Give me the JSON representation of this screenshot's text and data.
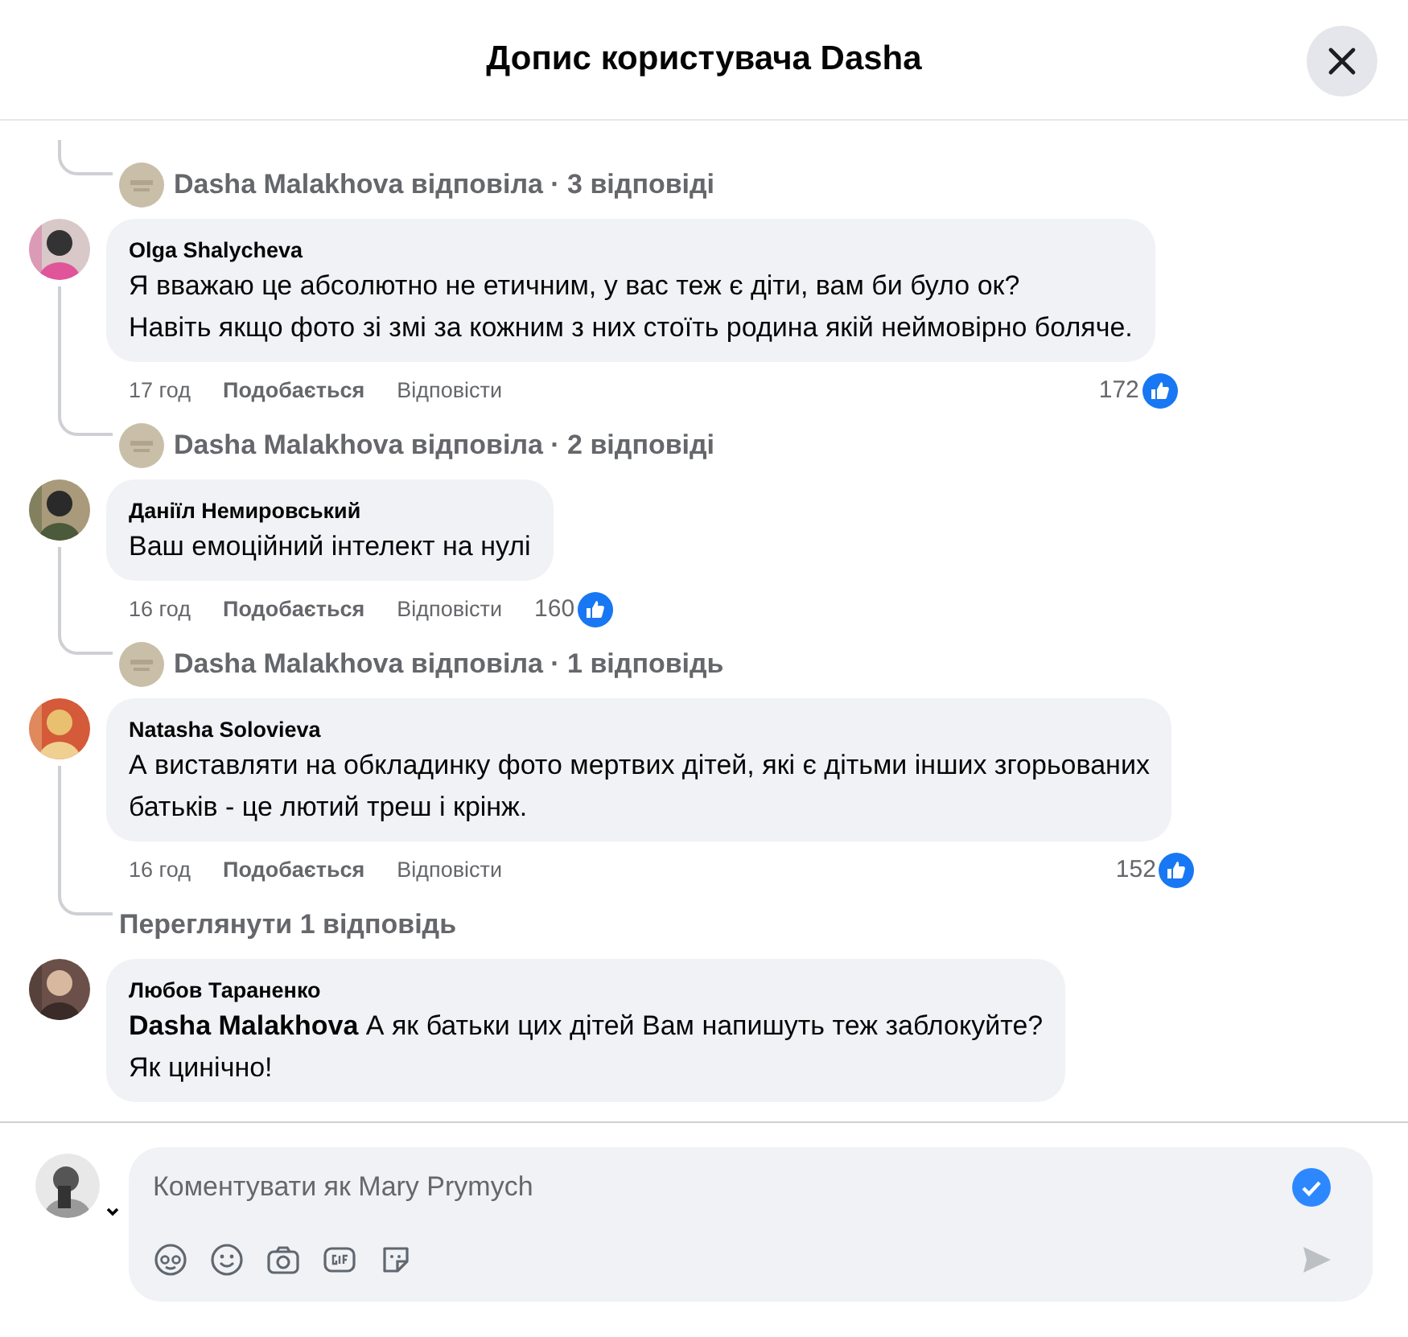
{
  "dialog": {
    "title": "Допис користувача Dasha"
  },
  "feed": [
    {
      "kind": "reply_summary",
      "text": "Dasha Malakhova відповіла · 3 відповіді"
    },
    {
      "kind": "comment",
      "author": "Olga Shalycheva",
      "lines": [
        "Я вважаю це абсолютно не етичним, у вас теж є діти, вам би було ок?",
        "Навіть якщо фото зі змі за кожним з них стоїть родина якій неймовірно боляче."
      ],
      "time": "17 год",
      "like": "Подобається",
      "reply": "Відповісти",
      "reactions": "172"
    },
    {
      "kind": "reply_summary",
      "text": "Dasha Malakhova відповіла · 2 відповіді"
    },
    {
      "kind": "comment",
      "author": "Даніїл Немировський",
      "lines": [
        "Ваш емоційний інтелект на нулі"
      ],
      "time": "16 год",
      "like": "Подобається",
      "reply": "Відповісти",
      "reactions": "160"
    },
    {
      "kind": "reply_summary",
      "text": "Dasha Malakhova відповіла · 1 відповідь"
    },
    {
      "kind": "comment",
      "author": "Natasha Solovieva",
      "lines": [
        "А виставляти на обкладинку фото мертвих дітей, які є дітьми інших згорьованих",
        "батьків - це лютий треш і крінж."
      ],
      "time": "16 год",
      "like": "Подобається",
      "reply": "Відповісти",
      "reactions": "152"
    },
    {
      "kind": "view_replies",
      "text": "Переглянути 1 відповідь"
    },
    {
      "kind": "comment",
      "author": "Любов Тараненко",
      "lines": [
        "**Dasha Malakhova** А як батьки цих дітей Вам напишуть теж заблокуйте?",
        "Як цинічно!"
      ]
    }
  ],
  "composer": {
    "placeholder": "Коментувати як Mary Prymych"
  }
}
